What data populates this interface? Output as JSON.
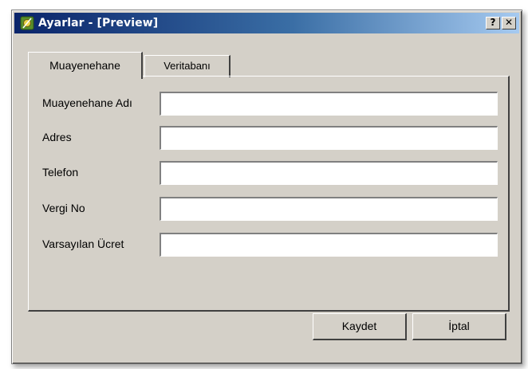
{
  "window": {
    "title": "Ayarlar - [Preview]",
    "help_button": "?",
    "close_button": "✕"
  },
  "tabs": [
    {
      "label": "Muayenehane",
      "active": true
    },
    {
      "label": "Veritabanı",
      "active": false
    }
  ],
  "form": {
    "fields": [
      {
        "label": "Muayenehane Adı",
        "value": ""
      },
      {
        "label": "Adres",
        "value": ""
      },
      {
        "label": "Telefon",
        "value": ""
      },
      {
        "label": "Vergi No",
        "value": ""
      },
      {
        "label": "Varsayılan Ücret",
        "value": ""
      }
    ]
  },
  "buttons": {
    "save_label": "Kaydet",
    "cancel_label": "İptal"
  },
  "colors": {
    "titlebar_start": "#0a246a",
    "titlebar_end": "#a6caf0",
    "face": "#d4d0c8"
  }
}
